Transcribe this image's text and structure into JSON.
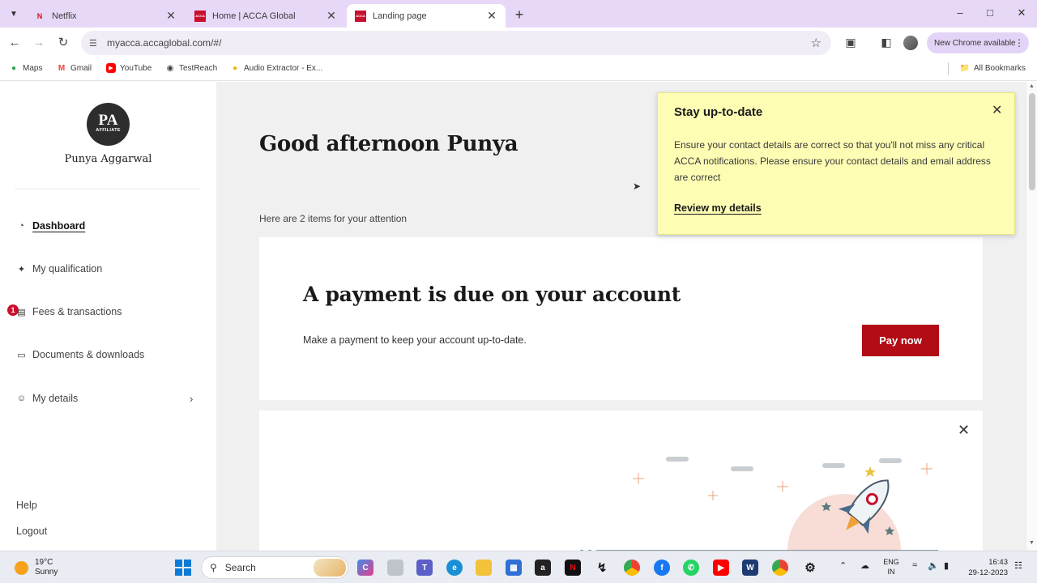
{
  "browser": {
    "tabs": [
      {
        "title": "Netflix",
        "fav": "N",
        "color": "#e50914"
      },
      {
        "title": "Home | ACCA Global",
        "fav": "ACCA",
        "color": "#c8102e"
      },
      {
        "title": "Landing page",
        "fav": "ACCA",
        "color": "#c8102e"
      }
    ],
    "url": "myacca.accaglobal.com/#/",
    "update_label": "New Chrome available",
    "bookmarks": [
      "Maps",
      "Gmail",
      "YouTube",
      "TestReach",
      "Audio Extractor - Ex..."
    ],
    "all_bookmarks": "All Bookmarks"
  },
  "sidebar": {
    "avatar_initials": "PA",
    "avatar_subtitle": "AFFILIATE",
    "user_name": "Punya Aggarwal",
    "items": [
      {
        "label": "Dashboard",
        "icon": "dashboard-icon"
      },
      {
        "label": "My qualification",
        "icon": "graduation-cap-icon"
      },
      {
        "label": "Fees & transactions",
        "icon": "receipt-icon",
        "badge": "1"
      },
      {
        "label": "Documents & downloads",
        "icon": "folder-icon"
      },
      {
        "label": "My details",
        "icon": "person-icon"
      }
    ],
    "help": "Help",
    "logout": "Logout"
  },
  "main": {
    "greeting": "Good afternoon Punya",
    "attention": "Here are 2 items for your attention",
    "payment_card": {
      "heading": "A payment is due on your account",
      "body": "Make a payment to keep your account up-to-date.",
      "button": "Pay now"
    }
  },
  "notification": {
    "title": "Stay up-to-date",
    "body": "Ensure your contact details are correct so that you'll not miss any critical ACCA notifications. Please ensure your contact details and email address are correct",
    "link": "Review my details"
  },
  "taskbar": {
    "temperature": "19°C",
    "condition": "Sunny",
    "search": "Search",
    "lang1": "ENG",
    "lang2": "IN",
    "time": "16:43",
    "date": "29-12-2023"
  },
  "colors": {
    "accent_red": "#b20c17",
    "toast_yellow": "#fdfdb4",
    "tabstrip": "#e6d8f6"
  }
}
